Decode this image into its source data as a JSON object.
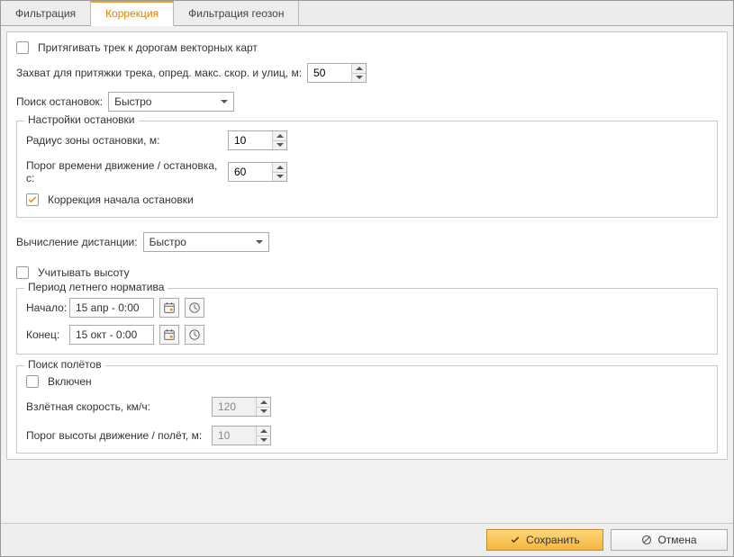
{
  "tabs": {
    "filter": "Фильтрация",
    "correction": "Коррекция",
    "geofilter": "Фильтрация геозон"
  },
  "snap": {
    "checkbox_label": "Притягивать трек к дорогам векторных карт",
    "capture_label": "Захват для притяжки трека, опред. макс. скор. и улиц, м:",
    "capture_value": "50",
    "stops_search_label": "Поиск остановок:",
    "stops_search_value": "Быстро"
  },
  "stop_settings": {
    "legend": "Настройки остановки",
    "radius_label": "Радиус зоны остановки, м:",
    "radius_value": "10",
    "threshold_label": "Порог времени движение / остановка, с:",
    "threshold_value": "60",
    "correction_begin": "Коррекция начала остановки"
  },
  "distance": {
    "label": "Вычисление дистанции:",
    "value": "Быстро"
  },
  "altitude": {
    "label": "Учитывать высоту"
  },
  "summer_period": {
    "legend": "Период летнего норматива",
    "start_label": "Начало:",
    "start_value": "15 апр - 0:00",
    "end_label": "Конец:",
    "end_value": "15 окт - 0:00"
  },
  "flights": {
    "legend": "Поиск полётов",
    "enabled_label": "Включен",
    "takeoff_label": "Взлётная скорость, км/ч:",
    "takeoff_value": "120",
    "alt_threshold_label": "Порог высоты движение / полёт, м:",
    "alt_threshold_value": "10"
  },
  "footer": {
    "save": "Сохранить",
    "cancel": "Отмена"
  }
}
